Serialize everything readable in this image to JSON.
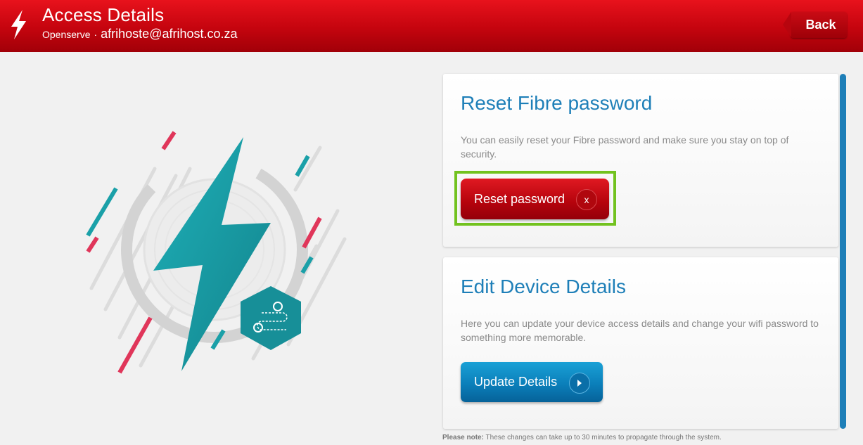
{
  "header": {
    "title": "Access Details",
    "provider": "Openserve",
    "separator": "·",
    "email": "afrihoste@afrihost.co.za",
    "back_label": "Back"
  },
  "cards": [
    {
      "title": "Reset Fibre password",
      "text": "You can easily reset your Fibre password and make sure you stay on top of security.",
      "button_label": "Reset password",
      "button_icon": "x",
      "button_icon_name": "close-icon"
    },
    {
      "title": "Edit Device Details",
      "text": "Here you can update your device access details and change your wifi password to something more memorable.",
      "button_label": "Update Details",
      "button_icon_name": "play-icon"
    }
  ],
  "note": {
    "prefix": "Please note:",
    "text": "These changes can take up to 30 minutes to propagate through the system."
  },
  "colors": {
    "brand_red": "#e8121c",
    "accent_blue": "#1e7fb8",
    "highlight_green": "#72c21f",
    "teal": "#1aa0a8",
    "pink": "#e0365a"
  }
}
